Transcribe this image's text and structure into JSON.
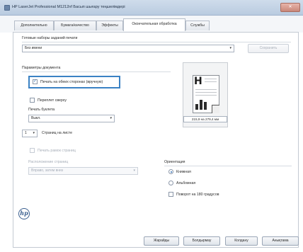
{
  "window": {
    "title": "HP LaserJet Professional M1212nf Басып шығару теңшелімдері",
    "close_label": "✕"
  },
  "tabs": [
    {
      "label": "Дополнительно"
    },
    {
      "label": "Бумага/качество"
    },
    {
      "label": "Эффекты"
    },
    {
      "label": "Окончательная обработка"
    },
    {
      "label": "Службы"
    }
  ],
  "presets": {
    "heading": "Готовые наборы заданий печати",
    "selected": "Без имени",
    "save_label": "Сохранить"
  },
  "document_options": {
    "heading": "Параметры документа",
    "duplex_manual_label": "Печать на обеих сторонах (вручную)",
    "duplex_manual_checked": true,
    "flip_pages_up_label": "Переплет сверху",
    "flip_pages_up_checked": false,
    "booklet_heading": "Печать буклета",
    "booklet_value": "Выкл.",
    "pages_per_sheet_value": "1",
    "pages_per_sheet_label": "Страниц на листе",
    "print_borders_label": "Печать рамок страниц",
    "print_borders_checked": false,
    "page_order_heading": "Расположение страниц",
    "page_order_value": "Вправо, затем вниз"
  },
  "preview": {
    "letter": "H",
    "paper_size": "215,9 на 279,4 мм"
  },
  "orientation": {
    "heading": "Ориентация",
    "portrait_label": "Книжная",
    "landscape_label": "Альбомная",
    "selected": "portrait",
    "rotate_label": "Поворот на 180 градусов",
    "rotate_checked": false
  },
  "footer": {
    "ok_label": "Жарайды",
    "cancel_label": "Болдырмау",
    "apply_label": "Колдану",
    "help_label": "Анықтама"
  },
  "colors": {
    "accent": "#3b82c4",
    "titlebar": "#c5d5e8",
    "brand": "#3a5f8f"
  }
}
